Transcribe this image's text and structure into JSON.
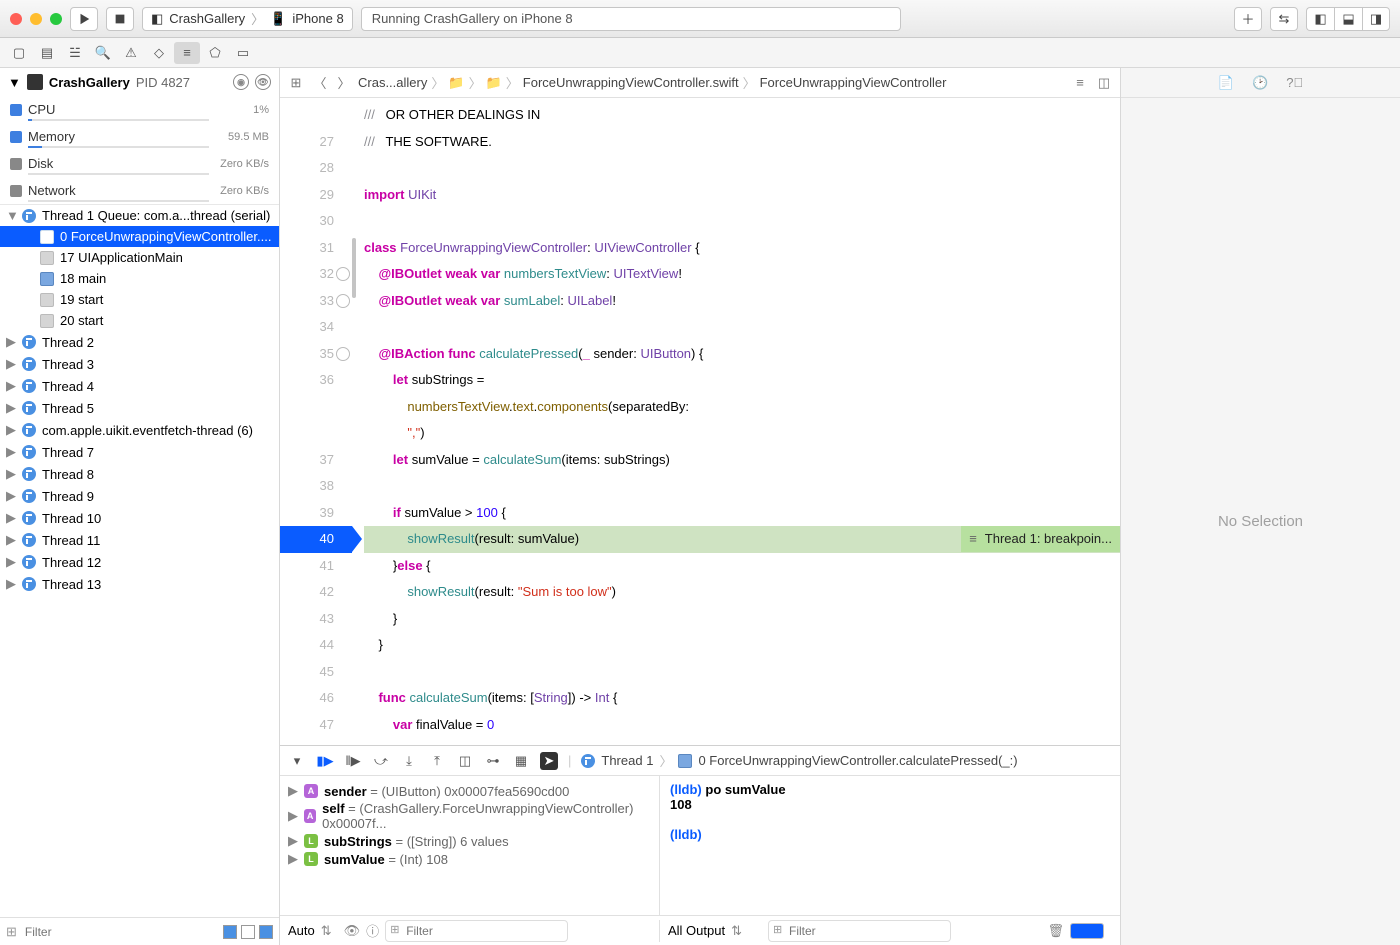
{
  "toolbar": {
    "scheme_app": "CrashGallery",
    "scheme_device": "iPhone 8",
    "activity": "Running CrashGallery on iPhone 8"
  },
  "navigator": {
    "process": "CrashGallery",
    "pid_label": "PID 4827",
    "gauges": [
      {
        "name": "CPU",
        "value": "1%",
        "cls": "g-cpu",
        "pct": 2
      },
      {
        "name": "Memory",
        "value": "59.5 MB",
        "cls": "g-mem",
        "pct": 8
      },
      {
        "name": "Disk",
        "value": "Zero KB/s",
        "cls": "g-disk",
        "pct": 0
      },
      {
        "name": "Network",
        "value": "Zero KB/s",
        "cls": "g-net",
        "pct": 0
      }
    ],
    "thread1_label": "Thread 1 Queue: com.a...thread (serial)",
    "frames": [
      {
        "n": "0",
        "label": "ForceUnwrappingViewController....",
        "sel": true,
        "grey": false
      },
      {
        "n": "17",
        "label": "UIApplicationMain",
        "sel": false,
        "grey": true
      },
      {
        "n": "18",
        "label": "main",
        "sel": false,
        "grey": false
      },
      {
        "n": "19",
        "label": "start",
        "sel": false,
        "grey": true
      },
      {
        "n": "20",
        "label": "start",
        "sel": false,
        "grey": true
      }
    ],
    "threads": [
      "Thread 2",
      "Thread 3",
      "Thread 4",
      "Thread 5",
      "com.apple.uikit.eventfetch-thread (6)",
      "Thread 7",
      "Thread 8",
      "Thread 9",
      "Thread 10",
      "Thread 11",
      "Thread 12",
      "Thread 13"
    ],
    "filter_ph": "Filter"
  },
  "jumpbar": {
    "crumbs": [
      "Cras...allery",
      "📁",
      "📁",
      "ForceUnwrappingViewController.swift",
      "ForceUnwrappingViewController"
    ]
  },
  "code": {
    "start": 27,
    "bp_line": 40,
    "bp_msg": "Thread 1: breakpoin...",
    "lines": [
      {
        "circ": false,
        "h": "<span class='cm'>///</span>   OR OTHER DEALINGS IN"
      },
      {
        "n": 27,
        "circ": false,
        "h": "<span class='cm'>///</span>   THE SOFTWARE."
      },
      {
        "n": 28,
        "circ": false,
        "h": ""
      },
      {
        "n": 29,
        "circ": false,
        "h": "<span class='kw'>import</span> <span class='ty'>UIKit</span>"
      },
      {
        "n": 30,
        "circ": false,
        "h": ""
      },
      {
        "n": 31,
        "circ": false,
        "h": "<span class='kw'>class</span> <span class='dec'>ForceUnwrappingViewController</span>: <span class='ty'>UIViewController</span> {"
      },
      {
        "n": 32,
        "circ": true,
        "h": "    <span class='at'>@IBOutlet</span> <span class='kw'>weak</span> <span class='kw'>var</span> <span class='fn'>numbersTextView</span>: <span class='ty'>UITextView</span>!"
      },
      {
        "n": 33,
        "circ": true,
        "h": "    <span class='at'>@IBOutlet</span> <span class='kw'>weak</span> <span class='kw'>var</span> <span class='fn'>sumLabel</span>: <span class='ty'>UILabel</span>!"
      },
      {
        "n": 34,
        "circ": false,
        "h": ""
      },
      {
        "n": 35,
        "circ": true,
        "h": "    <span class='at'>@IBAction</span> <span class='kw'>func</span> <span class='fn'>calculatePressed</span>(<span class='kw'>_</span> sender: <span class='ty'>UIButton</span>) {"
      },
      {
        "n": 36,
        "circ": false,
        "h": "        <span class='kw'>let</span> subStrings ="
      },
      {
        "n": 0,
        "circ": false,
        "h": "            <span class='py'>numbersTextView</span>.<span class='py'>text</span>.<span class='py'>components</span>(separatedBy:"
      },
      {
        "n": 0,
        "circ": false,
        "h": "            <span class='str'>\",\"</span>)"
      },
      {
        "n": 37,
        "circ": false,
        "h": "        <span class='kw'>let</span> sumValue = <span class='fn'>calculateSum</span>(items: subStrings)"
      },
      {
        "n": 38,
        "circ": false,
        "h": ""
      },
      {
        "n": 39,
        "circ": false,
        "h": "        <span class='kw'>if</span> sumValue &gt; <span class='num'>100</span> {"
      },
      {
        "n": 40,
        "circ": false,
        "bp": true,
        "h": "            <span class='fn'>showResult</span>(result: sumValue)"
      },
      {
        "n": 41,
        "circ": false,
        "h": "        }<span class='kw'>else</span> {"
      },
      {
        "n": 42,
        "circ": false,
        "h": "            <span class='fn'>showResult</span>(result: <span class='str'>\"Sum is too low\"</span>)"
      },
      {
        "n": 43,
        "circ": false,
        "h": "        }"
      },
      {
        "n": 44,
        "circ": false,
        "h": "    }"
      },
      {
        "n": 45,
        "circ": false,
        "h": ""
      },
      {
        "n": 46,
        "circ": false,
        "h": "    <span class='kw'>func</span> <span class='fn'>calculateSum</span>(items: [<span class='ty'>String</span>]) -&gt; <span class='ty'>Int</span> {"
      },
      {
        "n": 47,
        "circ": false,
        "h": "        <span class='kw'>var</span> finalValue = <span class='num'>0</span>"
      }
    ]
  },
  "debug": {
    "thread": "Thread 1",
    "frame": "0 ForceUnwrappingViewController.calculatePressed(_:)",
    "vars": [
      {
        "b": "A",
        "name": "sender",
        "rest": " = (UIButton) 0x00007fea5690cd00"
      },
      {
        "b": "A",
        "name": "self",
        "rest": " = (CrashGallery.ForceUnwrappingViewController) 0x00007f..."
      },
      {
        "b": "L",
        "name": "subStrings",
        "rest": " = ([String]) 6 values"
      },
      {
        "b": "L",
        "name": "sumValue",
        "rest": " = (Int) 108"
      }
    ],
    "console_cmd": "po sumValue",
    "console_out": "108",
    "auto": "Auto",
    "alloutput": "All Output",
    "filter_ph": "Filter"
  },
  "inspector": {
    "nosel": "No Selection"
  }
}
